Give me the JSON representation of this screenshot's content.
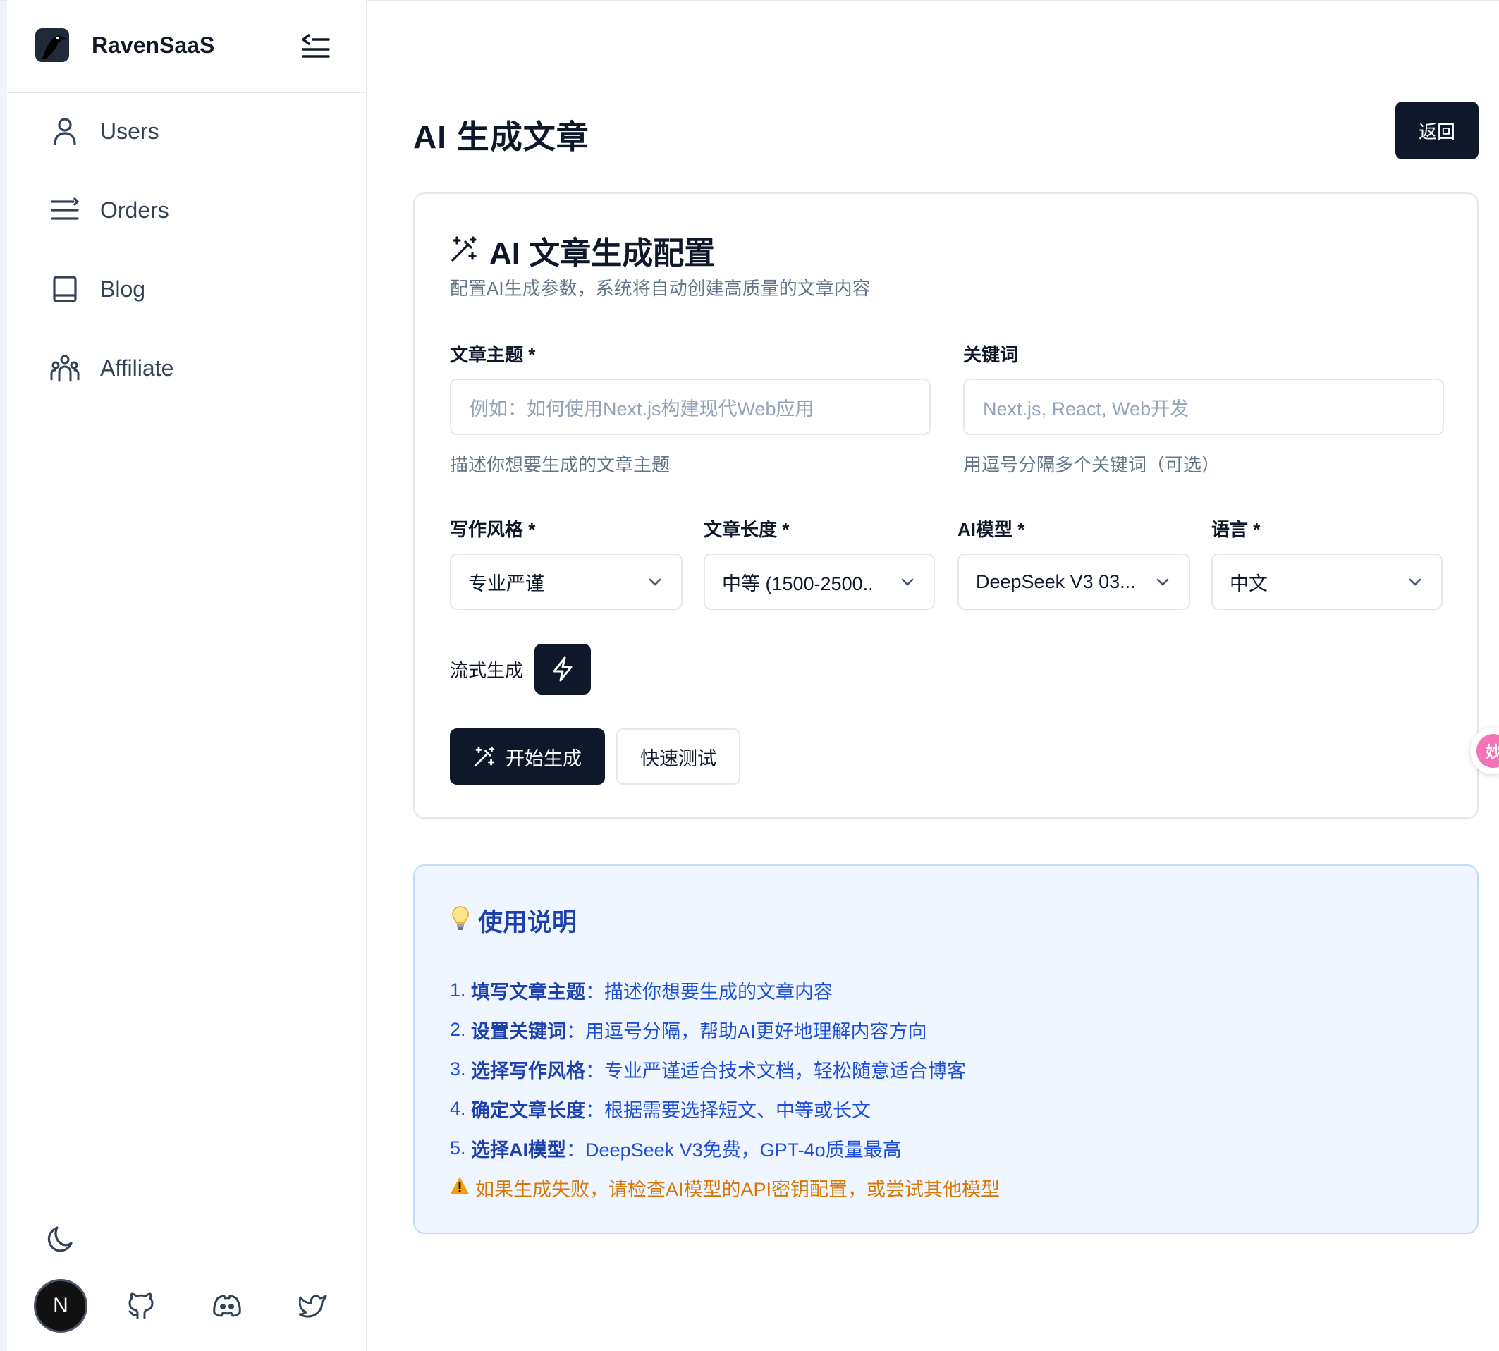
{
  "app": {
    "brand": "RavenSaaS"
  },
  "sidebar": {
    "items": [
      {
        "label": "Users",
        "icon": "user-icon"
      },
      {
        "label": "Orders",
        "icon": "list-icon"
      },
      {
        "label": "Blog",
        "icon": "book-icon"
      },
      {
        "label": "Affiliate",
        "icon": "team-icon"
      }
    ],
    "avatar_letter": "N",
    "social": [
      "github-icon",
      "discord-icon",
      "twitter-icon"
    ]
  },
  "header": {
    "title": "AI 生成文章",
    "back_label": "返回"
  },
  "config_card": {
    "title": "AI 文章生成配置",
    "description": "配置AI生成参数，系统将自动创建高质量的文章内容",
    "topic": {
      "label": "文章主题 *",
      "placeholder": "例如：如何使用Next.js构建现代Web应用",
      "helper": "描述你想要生成的文章主题"
    },
    "keywords": {
      "label": "关键词",
      "placeholder": "Next.js, React, Web开发",
      "helper": "用逗号分隔多个关键词（可选）"
    },
    "style": {
      "label": "写作风格 *",
      "value": "专业严谨"
    },
    "length": {
      "label": "文章长度 *",
      "value": "中等 (1500-2500.."
    },
    "model": {
      "label": "AI模型 *",
      "value": "DeepSeek V3 03..."
    },
    "language": {
      "label": "语言 *",
      "value": "中文"
    },
    "stream_label": "流式生成",
    "generate_label": "开始生成",
    "quick_test_label": "快速测试"
  },
  "help": {
    "title": "使用说明",
    "items": [
      {
        "prefix": "1. ",
        "bold": "填写文章主题",
        "text": "：描述你想要生成的文章内容"
      },
      {
        "prefix": "2. ",
        "bold": "设置关键词",
        "text": "：用逗号分隔，帮助AI更好地理解内容方向"
      },
      {
        "prefix": "3. ",
        "bold": "选择写作风格",
        "text": "：专业严谨适合技术文档，轻松随意适合博客"
      },
      {
        "prefix": "4. ",
        "bold": "确定文章长度",
        "text": "：根据需要选择短文、中等或长文"
      },
      {
        "prefix": "5. ",
        "bold": "选择AI模型",
        "text": "：DeepSeek V3免费，GPT-4o质量最高"
      }
    ],
    "warning": "如果生成失败，请检查AI模型的API密钥配置，或尝试其他模型"
  },
  "floating_widget_text": "妙"
}
